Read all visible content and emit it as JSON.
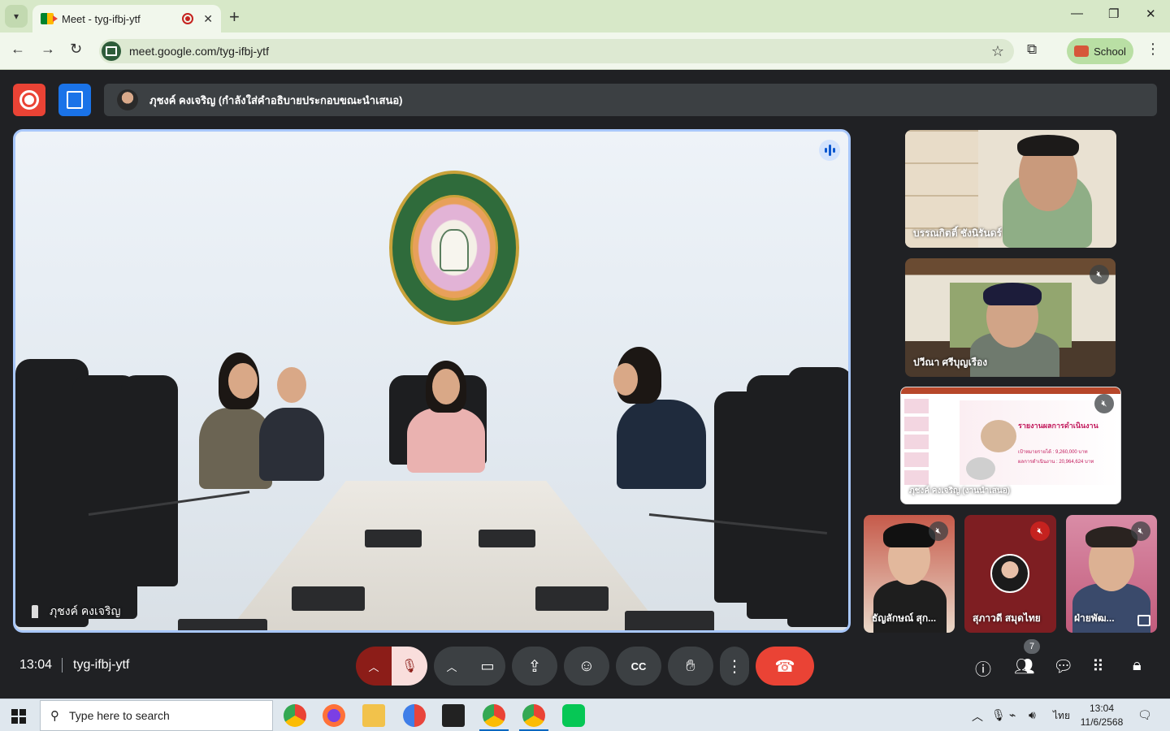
{
  "browser": {
    "tab_title": "Meet - tyg-ifbj-ytf",
    "url": "meet.google.com/tyg-ifbj-ytf",
    "profile_label": "School"
  },
  "meet": {
    "presenter_banner": "ภุชงค์ คงเจริญ (กำลังใส่คำอธิบายประกอบขณะนำเสนอ)",
    "main_speaker_name": "ภุชงค์ คงเจริญ",
    "participants": [
      {
        "name": "บรรณกิตติ์ ชังนิรันดร์",
        "muted": false
      },
      {
        "name": "ปวีณา ศรีบุญเรือง",
        "muted": true
      },
      {
        "name": "ภุชงค์ คงเจริญ (งานนำเสนอ)",
        "muted": true
      },
      {
        "name": "ธัญลักษณ์ สุก...",
        "muted": true
      },
      {
        "name": "สุภาวดี สมุดไทย",
        "muted": true
      },
      {
        "name": "ฝ่ายพัฒ...",
        "muted": true
      }
    ],
    "slide": {
      "title": "รายงานผลการดำเนินงาน",
      "line1": "เป้าหมายรายได้ : 9,260,000 บาท",
      "line2": "ผลการดำเนินงาน : 20,964,624 บาท"
    },
    "clock": "13:04",
    "meeting_code": "tyg-ifbj-ytf",
    "people_count": "7"
  },
  "taskbar": {
    "search_placeholder": "Type here to search",
    "language": "ไทย",
    "time": "13:04",
    "date": "11/6/2568"
  },
  "colors": {
    "accent_blue": "#a8c7fa",
    "end_call_red": "#ea4335",
    "mic_off_bg": "#f9dedc"
  }
}
